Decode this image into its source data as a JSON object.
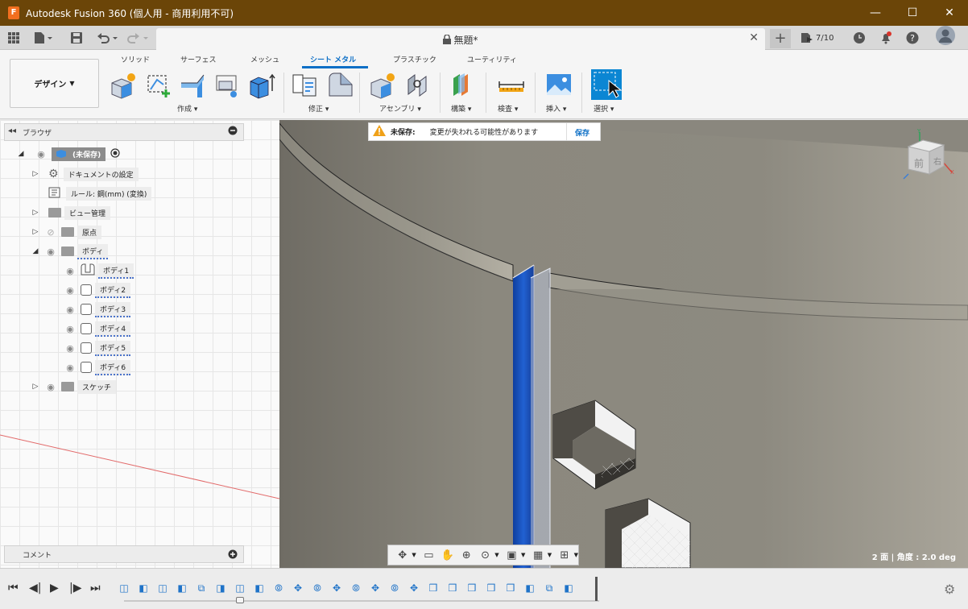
{
  "window": {
    "title": "Autodesk Fusion 360 (個人用 - 商用利用不可)",
    "logo_letter": "F",
    "minimize": "—",
    "maximize": "☐",
    "close": "✕"
  },
  "tabbar": {
    "doc_title": "無題*",
    "doc_close": "✕",
    "new_tab": "+",
    "jobs_count": "7/10"
  },
  "ribbon": {
    "workspace": "デザイン",
    "tabs": [
      "ソリッド",
      "サーフェス",
      "メッシュ",
      "シート メタル",
      "プラスチック",
      "ユーティリティ"
    ],
    "active_tab": 3,
    "groups": [
      "作成",
      "修正",
      "アセンブリ",
      "構築",
      "検査",
      "挿入",
      "選択"
    ]
  },
  "browser": {
    "title": "ブラウザ",
    "root_label": "(未保存)",
    "items": [
      {
        "label": "ドキュメントの設定"
      },
      {
        "label": "ルール: 鋼(mm) (変換)"
      },
      {
        "label": "ビュー管理"
      },
      {
        "label": "原点"
      },
      {
        "label": "ボディ"
      },
      {
        "label": "ボディ1"
      },
      {
        "label": "ボディ2"
      },
      {
        "label": "ボディ3"
      },
      {
        "label": "ボディ4"
      },
      {
        "label": "ボディ5"
      },
      {
        "label": "ボディ6"
      },
      {
        "label": "スケッチ"
      }
    ],
    "comments_label": "コメント"
  },
  "banner": {
    "status": "未保存:",
    "message": "変更が失われる可能性があります",
    "save_label": "保存"
  },
  "viewcube": {
    "front": "前",
    "right": "右"
  },
  "viewport_status": "2 面 | 角度 : 2.0 deg",
  "colors": {
    "titlebar": "#6b4508",
    "accent": "#0d6fc6",
    "sheet_blue": "#1849b8"
  }
}
